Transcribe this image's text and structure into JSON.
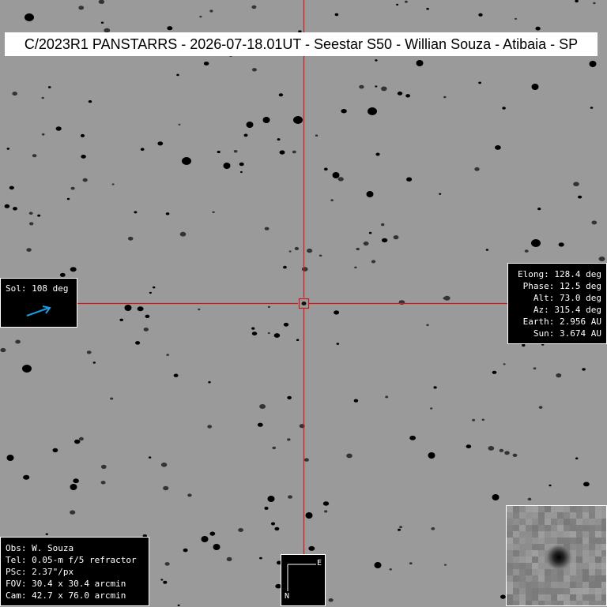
{
  "title": "C/2023R1 PANSTARRS - 2026-07-18.01UT - Seestar S50 - Willian Souza - Atibaia - SP",
  "sol": {
    "label": "Sol: 108 deg",
    "arrow_color": "#1e9be0"
  },
  "stats": [
    "Elong: 128.4 deg",
    "Phase: 12.5 deg",
    "Alt: 73.0 deg",
    "Az: 315.4 deg",
    "Earth: 2.956 AU",
    "Sun: 3.674 AU"
  ],
  "observer": [
    "Obs: W. Souza",
    "Tel: 0.05-m f/5 refractor",
    "PSc: 2.37\"/px",
    "FOV: 30.4 x 30.4 arcmin",
    "Cam: 42.7 x 76.0 arcmin"
  ],
  "compass": {
    "east": "E",
    "north": "N"
  },
  "colors": {
    "sky": "#9a9a9a",
    "crosshair": "#d01818",
    "star": "#000000"
  }
}
